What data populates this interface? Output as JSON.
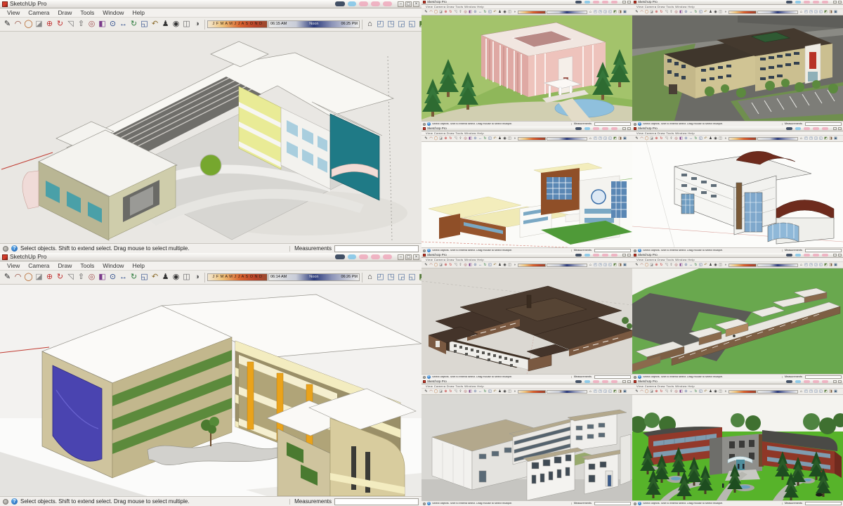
{
  "chrome": {
    "title": "SketchUp Pro",
    "menus": [
      "View",
      "Camera",
      "Draw",
      "Tools",
      "Window",
      "Help"
    ],
    "menu_line": "View   Camera   Draw   Tools   Window   Help",
    "status": "Select objects. Shift to extend select. Drag mouse to select multiple.",
    "measurements_label": "Measurements",
    "months": "J F M A M J J A S O N D",
    "minimize_label": "–",
    "maximize_label": "▢",
    "close_label": "×"
  },
  "windows": {
    "top_left": {
      "sunrise": "06:15 AM",
      "noon": "Noon",
      "sunset": "06:25 PM"
    },
    "bottom_left": {
      "sunrise": "06:14 AM",
      "noon": "Noon",
      "sunset": "06:26 PM"
    }
  },
  "toolbar": {
    "tools_left": [
      {
        "name": "line-tool",
        "glyph": "✎",
        "color": "#222222"
      },
      {
        "name": "arc-tool",
        "glyph": "◠",
        "color": "#8a3a2a"
      },
      {
        "name": "circle-tool",
        "glyph": "◯",
        "color": "#b05a1a"
      },
      {
        "name": "eraser-tool",
        "glyph": "◪",
        "color": "#888888"
      },
      {
        "name": "move-tool",
        "glyph": "⊕",
        "color": "#c03030"
      },
      {
        "name": "rotate-tool",
        "glyph": "↻",
        "color": "#c03030"
      },
      {
        "name": "scale-tool",
        "glyph": "◹",
        "color": "#777777"
      },
      {
        "name": "push-pull-tool",
        "glyph": "⇧",
        "color": "#555555"
      },
      {
        "name": "offset-tool",
        "glyph": "◎",
        "color": "#a05050"
      },
      {
        "name": "paint-bucket-tool",
        "glyph": "◧",
        "color": "#7a3a8a"
      },
      {
        "name": "zoom-tool",
        "glyph": "⊙",
        "color": "#2a4a8a"
      },
      {
        "name": "pan-tool",
        "glyph": "↔",
        "color": "#2a4a8a"
      },
      {
        "name": "orbit-tool",
        "glyph": "↻",
        "color": "#2a7a3a"
      },
      {
        "name": "zoom-extents-tool",
        "glyph": "◱",
        "color": "#2a4a8a"
      },
      {
        "name": "previous-view-tool",
        "glyph": "↶",
        "color": "#8a6a2a"
      },
      {
        "name": "position-camera-tool",
        "glyph": "♟",
        "color": "#333333"
      },
      {
        "name": "look-around-tool",
        "glyph": "◉",
        "color": "#333333"
      },
      {
        "name": "section-plane-tool",
        "glyph": "◫",
        "color": "#666666"
      },
      {
        "name": "shadows-toggle",
        "glyph": "◑",
        "color": "#555555"
      }
    ],
    "tools_right": [
      {
        "name": "iso-view",
        "glyph": "⌂",
        "color": "#333333"
      },
      {
        "name": "top-view",
        "glyph": "◰",
        "color": "#4a6a9a"
      },
      {
        "name": "front-view",
        "glyph": "◳",
        "color": "#4a6a9a"
      },
      {
        "name": "right-view",
        "glyph": "◲",
        "color": "#4a6a9a"
      },
      {
        "name": "back-view",
        "glyph": "◱",
        "color": "#4a6a9a"
      },
      {
        "name": "style-wireframe",
        "glyph": "◩",
        "color": "#557a3a"
      },
      {
        "name": "style-shaded",
        "glyph": "◨",
        "color": "#7a5a3a"
      },
      {
        "name": "style-textured",
        "glyph": "▣",
        "color": "#3a5a7a"
      }
    ]
  }
}
